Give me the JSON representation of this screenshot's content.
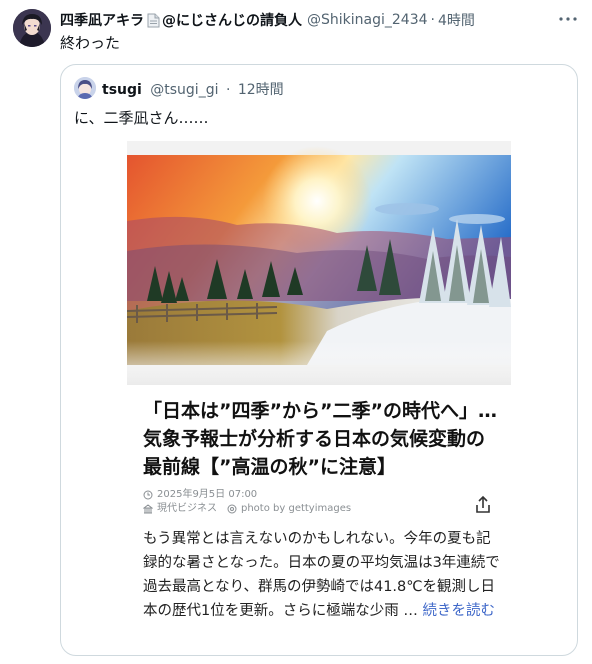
{
  "tweet": {
    "author_name": "四季凪アキラ",
    "author_name_suffix": "@にじさんじの請負人",
    "handle": "@Shikinagi_2434",
    "separator": "·",
    "time": "4時間",
    "more_icon": "more-icon",
    "text": "終わった"
  },
  "quote": {
    "author_name": "tsugi",
    "handle": "@tsugi_gi",
    "separator": "·",
    "time": "12時間",
    "text": "に、二季凪さん……"
  },
  "article": {
    "title": "「日本は”四季”から”二季”の時代へ」…気象予報士が分析する日本の気候変動の最前線【”高温の秋”に注意】",
    "date": "2025年9月5日 07:00",
    "source": "現代ビジネス",
    "photo_credit": "photo by gettyimages",
    "body": "もう異常とは言えないのかもしれない。今年の夏も記録的な暑さとなった。日本の夏の平均気温は3年連続で過去最高となり、群馬の伊勢崎では41.8℃を観測し日本の歴代1位を更新。さらに極端な少雨 …",
    "read_more": "続きを読む",
    "share_icon": "share-icon"
  },
  "colors": {
    "text_primary": "#0f1419",
    "text_secondary": "#536471",
    "border": "#cfd9de",
    "link": "#3f68c9"
  }
}
